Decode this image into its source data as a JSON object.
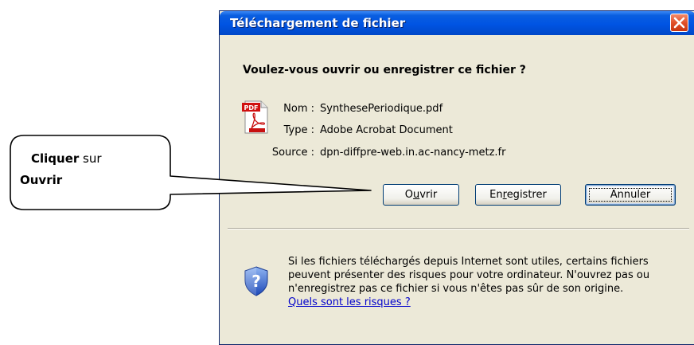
{
  "dialog": {
    "title": "Téléchargement de fichier",
    "question": "Voulez-vous ouvrir ou enregistrer ce fichier ?",
    "file_icon": "pdf-icon",
    "fields": {
      "name_label": "Nom :",
      "name_value": "SynthesePeriodique.pdf",
      "type_label": "Type :",
      "type_value": "Adobe Acrobat Document",
      "source_label": "Source :",
      "source_value": "dpn-diffpre-web.in.ac-nancy-metz.fr"
    },
    "buttons": {
      "open_prefix": "O",
      "open_underlined": "u",
      "open_suffix": "vrir",
      "save_prefix": "En",
      "save_underlined": "r",
      "save_suffix": "egistrer",
      "cancel": "Annuler"
    },
    "warning": {
      "line1": "Si les fichiers téléchargés depuis Internet sont utiles, certains fichiers",
      "line2": "peuvent présenter des risques pour votre ordinateur. N'ouvrez pas ou",
      "line3": "n'enregistrez pas ce fichier si vous n'êtes pas sûr de son origine.",
      "link": "Quels sont les risques ?",
      "icon": "shield-question-icon"
    },
    "colors": {
      "titlebar": "#0054e3",
      "close": "#e0502a",
      "body": "#ece9d8",
      "link": "#0000cc"
    }
  },
  "callout": {
    "bold1": "Cliquer",
    "text1": " sur",
    "bold2": "Ouvrir"
  }
}
